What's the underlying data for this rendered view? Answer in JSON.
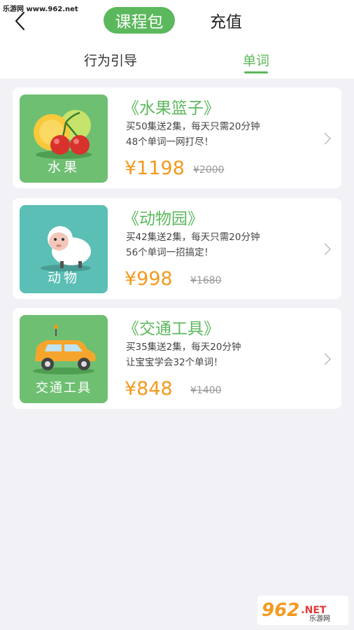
{
  "watermark": {
    "top": "乐游网 www.962.net",
    "bottom_num": "962",
    "bottom_net": ".NET",
    "bottom_cn": "乐游网"
  },
  "header": {
    "back_icon": "chevron-left-icon",
    "tabs": [
      {
        "label": "课程包",
        "active": true
      },
      {
        "label": "充值",
        "active": false
      }
    ]
  },
  "subtabs": [
    {
      "label": "行为引导",
      "active": false
    },
    {
      "label": "单词",
      "active": true
    }
  ],
  "colors": {
    "accent": "#5cb85c",
    "price": "#f39a1e",
    "background": "#f2f2f6"
  },
  "courses": [
    {
      "thumb_label": "水果",
      "thumb_color": "#6fbf73",
      "title": "《水果篮子》",
      "desc1": "买50集送2集，每天只需20分钟",
      "desc2": "48个单词一网打尽！",
      "price": "¥1198",
      "original": "¥2000"
    },
    {
      "thumb_label": "动物",
      "thumb_color": "#5bbfb5",
      "title": "《动物园》",
      "desc1": "买42集送2集，每天只需20分钟",
      "desc2": "56个单词一招搞定！",
      "price": "¥998",
      "original": "¥1680"
    },
    {
      "thumb_label": "交通工具",
      "thumb_color": "#6fbf73",
      "title": "《交通工具》",
      "desc1": "买35集送2集，每天20分钟",
      "desc2": "让宝宝学会32个单词！",
      "price": "¥848",
      "original": "¥1400"
    }
  ]
}
